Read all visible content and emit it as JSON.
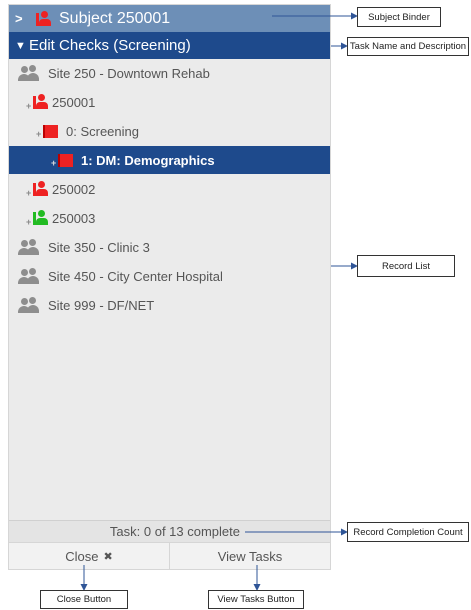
{
  "binder": {
    "title": "Subject 250001",
    "chevron": ">"
  },
  "task": {
    "title": "Edit Checks (Screening)"
  },
  "records": [
    {
      "type": "site",
      "label": "Site 250 - Downtown Rehab"
    },
    {
      "type": "subject",
      "label": "250001",
      "status_color": "#ee2222"
    },
    {
      "type": "visit",
      "label": "0: Screening"
    },
    {
      "type": "form",
      "label": "1: DM: Demographics",
      "selected": true
    },
    {
      "type": "subject",
      "label": "250002",
      "status_color": "#ee2222"
    },
    {
      "type": "subject",
      "label": "250003",
      "status_color": "#22bb22"
    },
    {
      "type": "site",
      "label": "Site 350 - Clinic 3"
    },
    {
      "type": "site",
      "label": "Site 450 - City Center Hospital"
    },
    {
      "type": "site",
      "label": "Site 999 - DF/NET"
    }
  ],
  "footer": {
    "task_progress": "Task: 0 of 13 complete",
    "close_label": "Close",
    "close_icon": "✖",
    "view_tasks_label": "View Tasks"
  },
  "annotations": {
    "subject_binder": "Subject Binder",
    "task_name": "Task Name and Description",
    "record_list": "Record List",
    "completion_count": "Record Completion Count",
    "close_button": "Close Button",
    "view_tasks_button": "View Tasks Button"
  },
  "colors": {
    "binder_bg": "#6d8fb7",
    "task_bg": "#1e4a8c",
    "selected_bg": "#1e4a8c",
    "status_red": "#ee2222",
    "status_green": "#22bb22"
  }
}
